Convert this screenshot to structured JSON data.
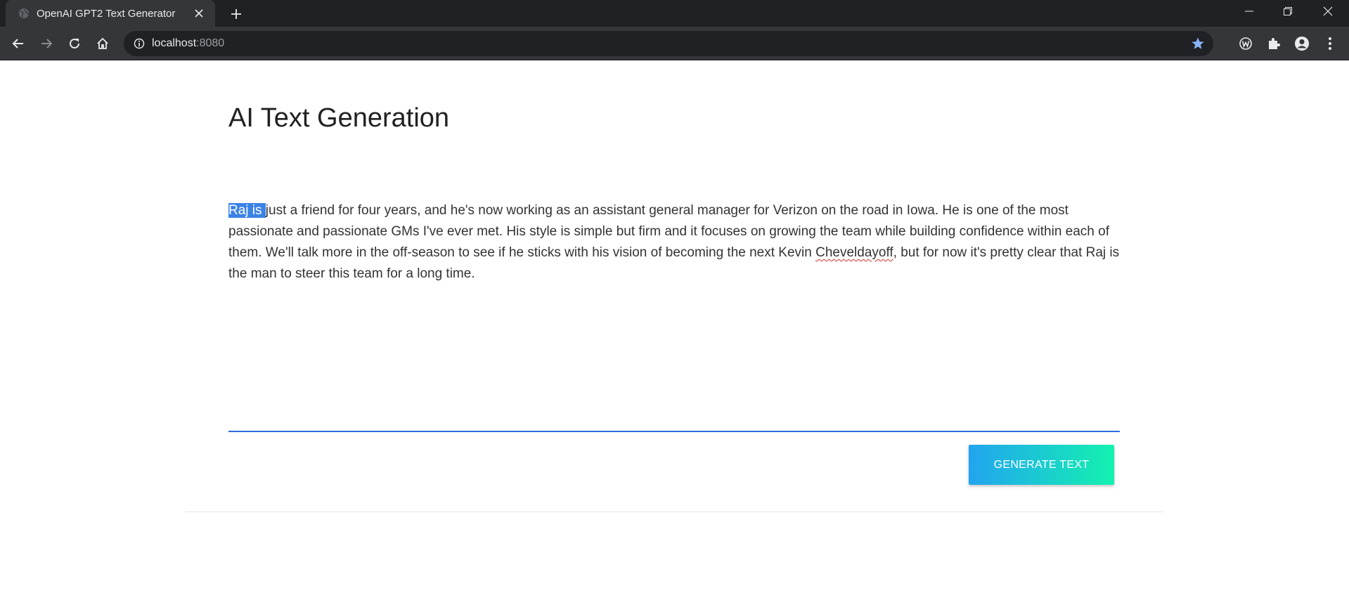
{
  "browser": {
    "tab_title": "OpenAI GPT2 Text Generator",
    "url_host": "localhost",
    "url_port": ":8080"
  },
  "page": {
    "title": "AI Text Generation",
    "text_selected": "Raj is ",
    "text_part1": " just  a friend for four years, and he's now working as an assistant general manager for Verizon on the road in Iowa.  He is one of the most passionate and passionate GMs I've ever met.  His style is simple but firm and it focuses on growing the team while building confidence within each of them. We'll talk more in the off-season to see if he sticks with his vision of becoming the next Kevin ",
    "text_misspelled": "Cheveldayoff",
    "text_part2": ", but for now it's pretty clear that Raj is the man to steer this team for a long time.",
    "generate_button": "GENERATE TEXT"
  },
  "colors": {
    "accent_blue": "#2f6be0",
    "button_gradient_start": "#22a4f0",
    "button_gradient_end": "#13f2b0",
    "bookmark_star": "#8ab4f8"
  }
}
